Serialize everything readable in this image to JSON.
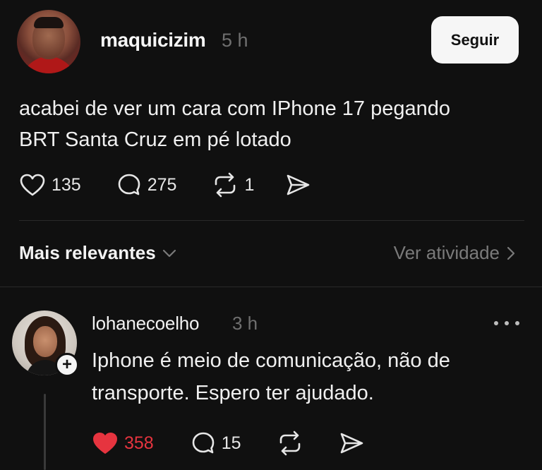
{
  "post": {
    "username": "maquicizim",
    "time": "5 h",
    "follow_label": "Seguir",
    "text_line1": "acabei de ver um cara com IPhone 17 pegando",
    "text_line2": "BRT Santa Cruz em pé lotado",
    "likes": "135",
    "comments": "275",
    "reposts": "1"
  },
  "replies_header": {
    "sort_label": "Mais relevantes",
    "activity_label": "Ver atividade"
  },
  "reply": {
    "username": "lohanecoelho",
    "time": "3 h",
    "text_line1": "Iphone é meio de comunicação, não de",
    "text_line2": "transporte. Espero ter ajudado.",
    "likes": "358",
    "comments": "15",
    "liked": true
  },
  "colors": {
    "background": "#101010",
    "liked": "#e6343f",
    "muted": "#6f6f6f"
  },
  "icons": [
    "heart-icon",
    "comment-icon",
    "repost-icon",
    "share-icon",
    "chevron-down-icon",
    "chevron-right-icon",
    "more-icon",
    "plus-icon"
  ]
}
